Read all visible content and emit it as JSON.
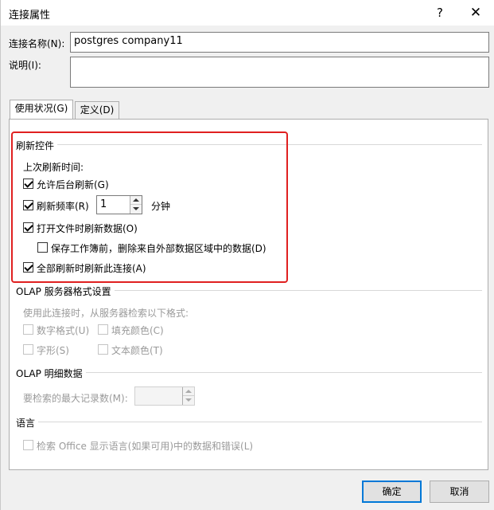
{
  "dialog": {
    "title": "连接属性",
    "help": "?",
    "close": "✕"
  },
  "fields": {
    "name_label": "连接名称(N):",
    "name_value": "postgres company11",
    "desc_label": "说明(I):",
    "desc_value": ""
  },
  "tabs": [
    {
      "label": "使用状况(G)",
      "active": true
    },
    {
      "label": "定义(D)",
      "active": false
    }
  ],
  "refresh": {
    "section": "刷新控件",
    "last_refresh_label": "上次刷新时间:",
    "bg_refresh": {
      "label": "允许后台刷新(G)",
      "checked": true
    },
    "interval": {
      "label": "刷新频率(R)",
      "checked": true,
      "value": "1",
      "unit": "分钟"
    },
    "on_open": {
      "label": "打开文件时刷新数据(O)",
      "checked": true
    },
    "remove_data": {
      "label": "保存工作簿前，删除来自外部数据区域中的数据(D)",
      "checked": false
    },
    "refresh_all": {
      "label": "全部刷新时刷新此连接(A)",
      "checked": true
    }
  },
  "olap_format": {
    "section": "OLAP 服务器格式设置",
    "desc": "使用此连接时，从服务器检索以下格式:",
    "number_format": "数字格式(U)",
    "fill_color": "填充颜色(C)",
    "font_style": "字形(S)",
    "text_color": "文本颜色(T)"
  },
  "olap_drill": {
    "section": "OLAP 明细数据",
    "max_records_label": "要检索的最大记录数(M):",
    "max_records_value": ""
  },
  "language": {
    "section": "语言",
    "option": "检索 Office 显示语言(如果可用)中的数据和错误(L)"
  },
  "buttons": {
    "ok": "确定",
    "cancel": "取消"
  },
  "colors": {
    "highlight_box": "#e02020",
    "default_button_border": "#0078d7"
  }
}
